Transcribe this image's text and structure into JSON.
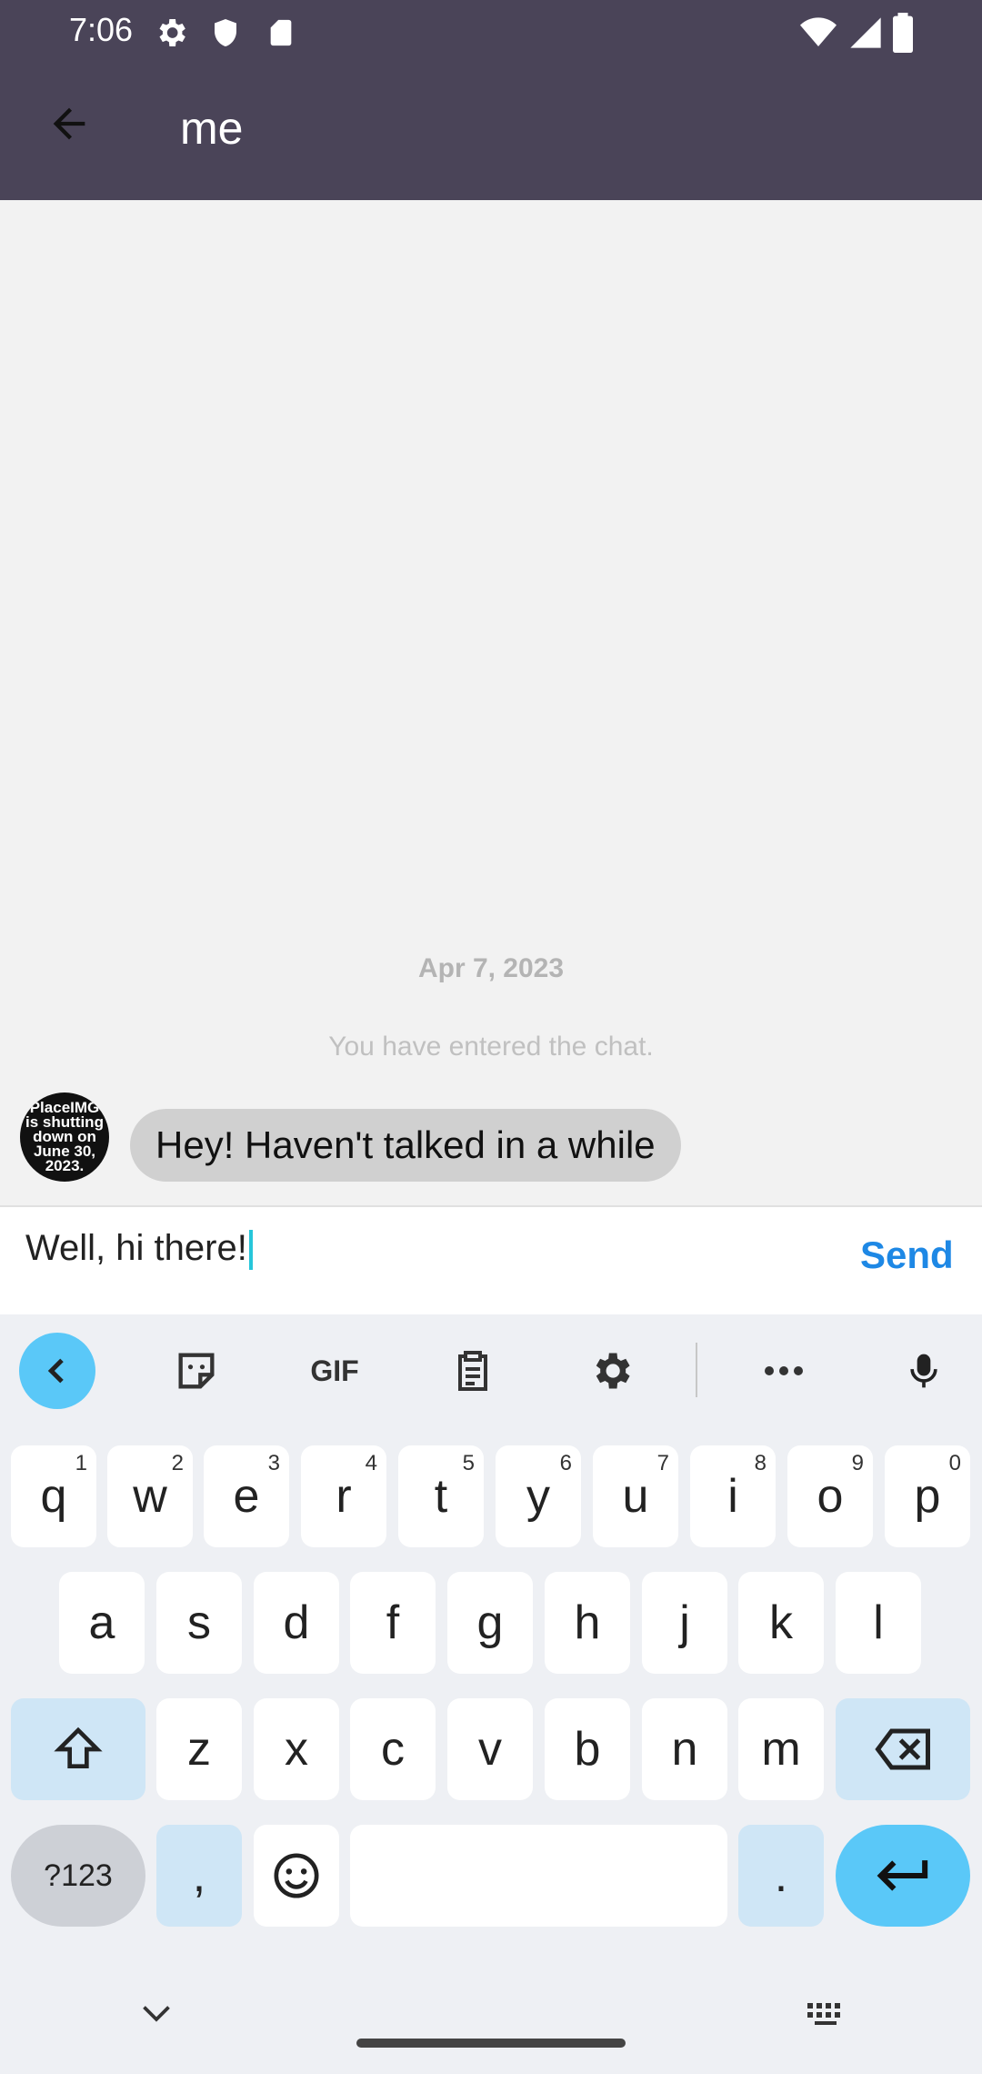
{
  "status_bar": {
    "time": "7:06",
    "icons": [
      "gear-icon",
      "shield-icon",
      "sd-card-icon",
      "wifi-icon",
      "signal-icon",
      "battery-icon"
    ]
  },
  "app_bar": {
    "title": "me",
    "background_color": "#4a4458"
  },
  "chat": {
    "date_separator": "Apr 7, 2023",
    "system_message": "You have entered the chat.",
    "messages": [
      {
        "avatar_text": "PlaceIMG is shutting down on June 30, 2023.",
        "text": "Hey! Haven't talked in a while"
      }
    ]
  },
  "composer": {
    "value": "Well, hi there!",
    "send_label": "Send",
    "send_color": "#1e88e5"
  },
  "keyboard": {
    "toolbar": [
      "back-icon",
      "sticker-icon",
      "gif-icon",
      "clipboard-icon",
      "settings-icon",
      "more-icon",
      "mic-icon"
    ],
    "gif_label": "GIF",
    "row1": [
      {
        "key": "q",
        "hint": "1"
      },
      {
        "key": "w",
        "hint": "2"
      },
      {
        "key": "e",
        "hint": "3"
      },
      {
        "key": "r",
        "hint": "4"
      },
      {
        "key": "t",
        "hint": "5"
      },
      {
        "key": "y",
        "hint": "6"
      },
      {
        "key": "u",
        "hint": "7"
      },
      {
        "key": "i",
        "hint": "8"
      },
      {
        "key": "o",
        "hint": "9"
      },
      {
        "key": "p",
        "hint": "0"
      }
    ],
    "row2": [
      "a",
      "s",
      "d",
      "f",
      "g",
      "h",
      "j",
      "k",
      "l"
    ],
    "row3": [
      "z",
      "x",
      "c",
      "v",
      "b",
      "n",
      "m"
    ],
    "numbers_label": "?123",
    "comma_label": ",",
    "period_label": ".",
    "accent_color": "#5ac8f8"
  },
  "nav_bar": {
    "icons": [
      "chevron-down-icon",
      "keyboard-icon"
    ]
  }
}
